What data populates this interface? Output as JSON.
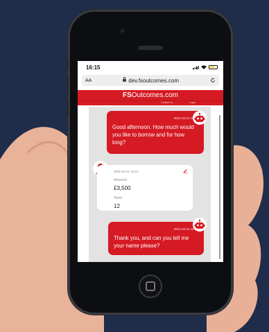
{
  "status": {
    "time": "16:15"
  },
  "browser": {
    "text_size": "AA",
    "url": "dev.fsoutcomes.com"
  },
  "site": {
    "logo_prefix": "FS",
    "logo_main": "Outcomes.com",
    "nav_contact": "Contact Us",
    "nav_login": "Login"
  },
  "messages": [
    {
      "sender": "bot",
      "timestamp": "2021-04-21 16:15",
      "text": "Good afternoon. How much would you like to borrow and for how long?"
    },
    {
      "sender": "user",
      "timestamp": "2021-04-21 16:15",
      "amount_label": "Amount",
      "amount_value": "£3,500",
      "term_label": "Term",
      "term_value": "12"
    },
    {
      "sender": "bot",
      "timestamp": "2021-04-21 16:15",
      "text": "Thank you, and can you tell me your name please?"
    }
  ],
  "colors": {
    "brand": "#d51a23",
    "background": "#1f2d4a"
  }
}
